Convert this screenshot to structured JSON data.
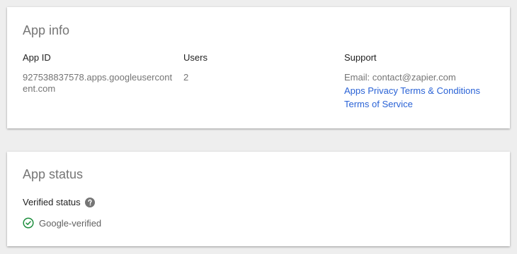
{
  "app_info": {
    "title": "App info",
    "columns": {
      "app_id": {
        "label": "App ID",
        "value": "927538837578.apps.googleusercontent.com"
      },
      "users": {
        "label": "Users",
        "value": "2"
      },
      "support": {
        "label": "Support",
        "email": "Email: contact@zapier.com",
        "links": [
          "Apps Privacy Terms & Conditions",
          "Terms of Service"
        ]
      }
    }
  },
  "app_status": {
    "title": "App status",
    "verified_label": "Verified status",
    "verified_value": "Google-verified"
  },
  "colors": {
    "link": "#2962d6",
    "verified_green": "#1e8e3e",
    "help_icon": "#757575"
  },
  "icons": {
    "help": "help-circle-icon",
    "verified": "check-circle-icon"
  }
}
